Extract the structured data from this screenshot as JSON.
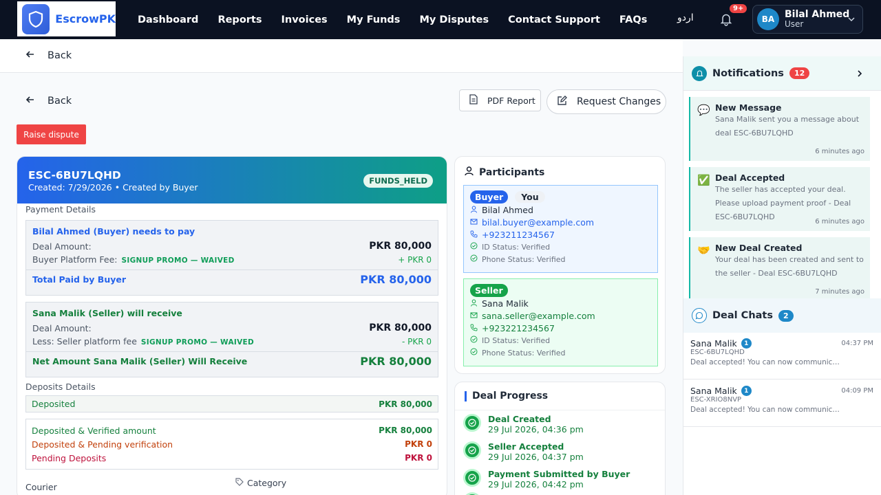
{
  "app": {
    "name": "EscrowPK"
  },
  "nav": {
    "items": [
      "Dashboard",
      "Reports",
      "Invoices",
      "My Funds",
      "My Disputes",
      "Contact Support",
      "FAQs"
    ],
    "lang": "اردو",
    "bell_badge": "9+",
    "user_initials": "BA",
    "user_name": "Bilal Ahmed",
    "user_role": "User"
  },
  "page": {
    "back_top": "Back",
    "back_main": "Back",
    "pdf_button": "PDF Report",
    "request_button": "Request Changes",
    "dispute_button": "Raise dispute"
  },
  "deal": {
    "id": "ESC-6BU7LQHD",
    "created": "Created: 7/29/2026 • Created by Buyer",
    "status": "FUNDS_HELD",
    "payment_label": "Payment Details",
    "buyer_box": {
      "title": "Bilal Ahmed (Buyer) needs to pay",
      "deal_amount_label": "Deal Amount:",
      "deal_amount": "PKR 80,000",
      "fee_label": "Buyer Platform Fee:",
      "fee_promo": "SIGNUP PROMO — WAIVED",
      "fee_amount": "+ PKR 0",
      "total_label": "Total Paid by Buyer",
      "total_amount": "PKR 80,000"
    },
    "seller_box": {
      "title": "Sana Malik (Seller) will receive",
      "deal_amount_label": "Deal Amount:",
      "deal_amount": "PKR 80,000",
      "fee_label": "Less: Seller platform fee",
      "fee_promo": "SIGNUP PROMO — WAIVED",
      "fee_amount": "- PKR 0",
      "net_label": "Net Amount Sana Malik (Seller) Will Receive",
      "net_amount": "PKR 80,000"
    },
    "deposits_label": "Deposits Details",
    "deposited_label": "Deposited",
    "deposited_amount": "PKR 80,000",
    "verified_label": "Deposited & Verified amount",
    "verified_amount": "PKR 80,000",
    "pending_verif_label": "Deposited & Pending verification",
    "pending_verif_amount": "PKR 0",
    "pending_label": "Pending Deposits",
    "pending_amount": "PKR 0",
    "courier_label": "Courier",
    "category_label": "Category"
  },
  "participants": {
    "title": "Participants",
    "buyer": {
      "tag": "Buyer",
      "you": "You",
      "name": "Bilal Ahmed",
      "email": "bilal.buyer@example.com",
      "phone": "+923211234567",
      "id_status": "ID Status: Verified",
      "phone_status": "Phone Status: Verified"
    },
    "seller": {
      "tag": "Seller",
      "name": "Sana Malik",
      "email": "sana.seller@example.com",
      "phone": "+923221234567",
      "id_status": "ID Status: Verified",
      "phone_status": "Phone Status: Verified"
    }
  },
  "progress": {
    "title": "Deal Progress",
    "steps": [
      {
        "title": "Deal Created",
        "date": "29 Jul 2026, 04:36 pm"
      },
      {
        "title": "Seller Accepted",
        "date": "29 Jul 2026, 04:37 pm"
      },
      {
        "title": "Payment Submitted by Buyer",
        "date": "29 Jul 2026, 04:42 pm"
      }
    ]
  },
  "notifications": {
    "title": "Notifications",
    "count": "12",
    "items": [
      {
        "title": "New Message",
        "body": "Sana Malik sent you a message about deal ESC-6BU7LQHD",
        "time": "6 minutes ago",
        "icon": "💬"
      },
      {
        "title": "Deal Accepted",
        "body": "The seller has accepted your deal. Please upload payment proof - Deal ESC-6BU7LQHD",
        "time": "6 minutes ago",
        "icon": "✅"
      },
      {
        "title": "New Deal Created",
        "body": "Your deal has been created and sent to the seller - Deal ESC-6BU7LQHD",
        "time": "7 minutes ago",
        "icon": "🤝"
      }
    ]
  },
  "chats": {
    "title": "Deal Chats",
    "count": "2",
    "items": [
      {
        "name": "Sana Malik",
        "badge": "1",
        "deal": "ESC-6BU7LQHD",
        "msg": "Deal accepted! You can now communicate te...",
        "time": "04:37 PM"
      },
      {
        "name": "Sana Malik",
        "badge": "1",
        "deal": "ESC-XRIO8NVP",
        "msg": "Deal accepted! You can now communicate te...",
        "time": "04:09 PM"
      }
    ]
  }
}
